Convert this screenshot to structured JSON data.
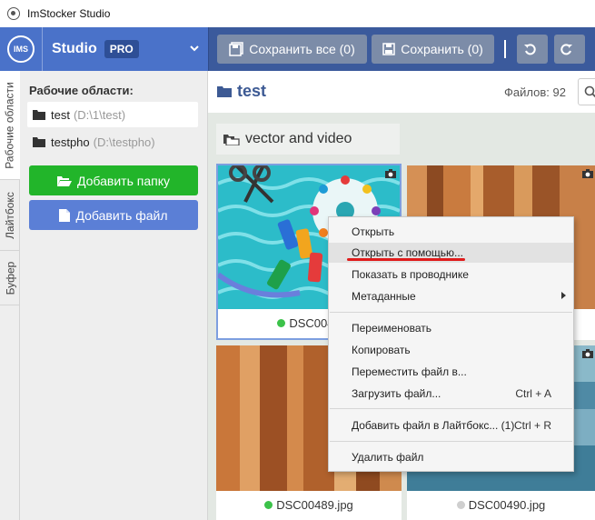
{
  "window": {
    "title": "ImStocker Studio"
  },
  "header": {
    "logo_text": "IMS",
    "brand_name": "Studio",
    "badge": "PRO",
    "save_all_label": "Сохранить все (0)",
    "save_label": "Сохранить (0)",
    "separator": "|"
  },
  "side_tabs": [
    "Рабочие области",
    "Лайтбокс",
    "Буфер"
  ],
  "workspaces": {
    "title": "Рабочие области:",
    "items": [
      {
        "name": "test",
        "path": "(D:\\1\\test)"
      },
      {
        "name": "testpho",
        "path": "(D:\\testpho)"
      }
    ],
    "add_folder_label": "Добавить папку",
    "add_file_label": "Добавить файл"
  },
  "main": {
    "folder_name": "test",
    "files_count": "Файлов: 92",
    "subfolder": "vector and video",
    "files": [
      {
        "name": "DSC0046",
        "status": "green"
      },
      {
        "name": "DSC00489.jpg",
        "status": "green"
      },
      {
        "name": "DSC00490.jpg",
        "status": "grey"
      }
    ]
  },
  "context_menu": {
    "items": [
      {
        "label": "Открыть"
      },
      {
        "label": "Открыть с помощью..."
      },
      {
        "label": "Показать в проводнике"
      },
      {
        "label": "Метаданные"
      },
      {
        "label": "Переименовать"
      },
      {
        "label": "Копировать"
      },
      {
        "label": "Переместить файл в..."
      },
      {
        "label": "Загрузить файл...",
        "shortcut": "Ctrl + A"
      },
      {
        "label": "Добавить файл в Лайтбокс... (1)",
        "shortcut": "Ctrl + R"
      },
      {
        "label": "Удалить файл"
      }
    ]
  },
  "colors": {
    "header_blue": "#4a72c9",
    "toolbar_blue": "#3b5a9c",
    "add_folder_green": "#22b52a",
    "add_file_blue": "#5b7fd6",
    "status_green": "#3cc24a",
    "status_grey": "#cfcfcf",
    "annotation_red": "#e01b1b"
  }
}
